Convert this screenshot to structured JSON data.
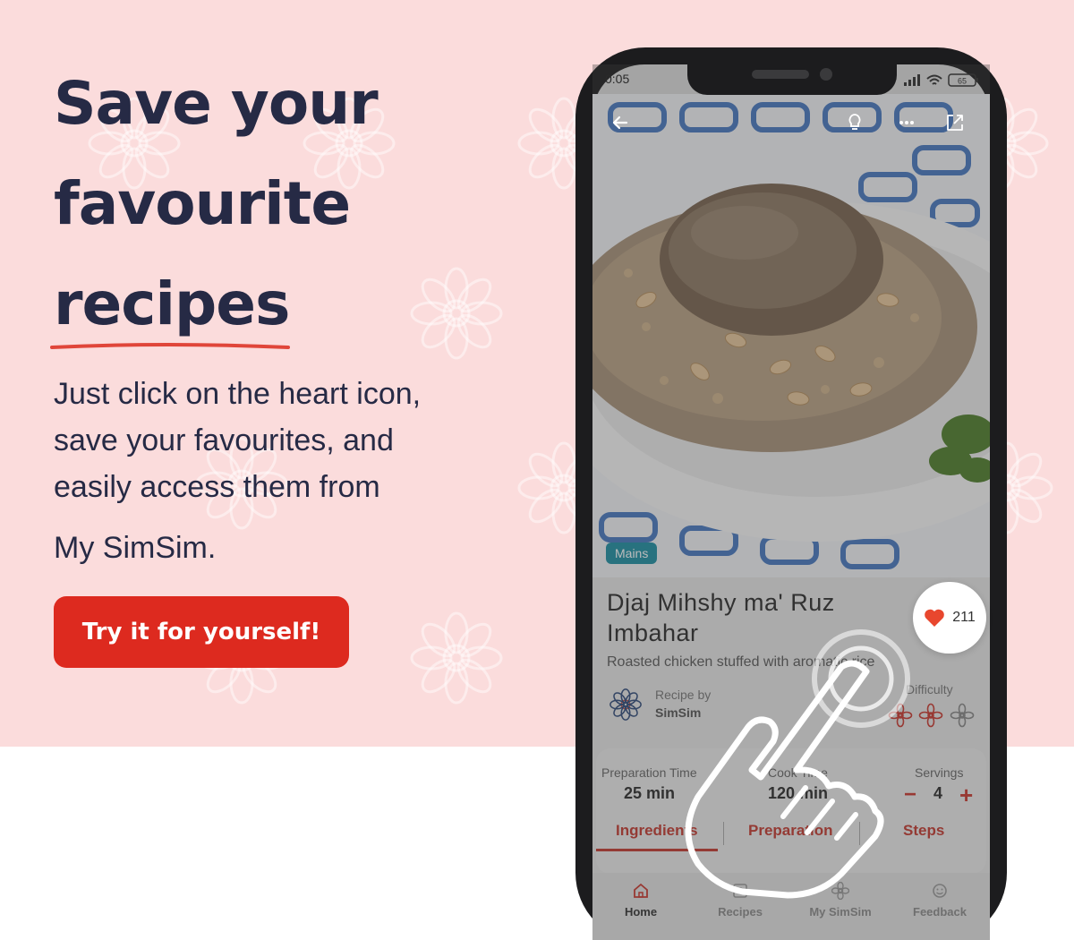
{
  "hero": {
    "headline_line1": "Save your",
    "headline_line2": "favourite",
    "headline_line3": "recipes",
    "body_line1": "Just click on the heart icon,",
    "body_line2": "save your favourites, and",
    "body_line3": "easily access them from",
    "body_line4": "My SimSim.",
    "cta_label": "Try it for yourself!"
  },
  "colors": {
    "background_pink": "#fbdcdc",
    "headline": "#262a45",
    "cta": "#dd2a1f",
    "accent_red": "#c43a30",
    "badge_teal": "#1e8fa3"
  },
  "phone": {
    "status_time": "0:05",
    "battery": "65",
    "top_icons": [
      "back-arrow-icon",
      "lightbulb-icon",
      "more-dots-icon",
      "share-icon"
    ],
    "recipe": {
      "category": "Mains",
      "title_line1": "Djaj Mihshy ma' Ruz",
      "title_line2": "Imbahar",
      "subtitle": "Roasted chicken stuffed with aromatic rice",
      "recipe_by_label": "Recipe by",
      "author": "SimSim",
      "difficulty_label": "Difficulty",
      "difficulty_level": 2,
      "difficulty_max": 3,
      "favourite_count": "211"
    },
    "info": {
      "prep_label": "Preparation Time",
      "prep_value": "25 min",
      "cook_label": "Cook Time",
      "cook_value": "120 min",
      "servings_label": "Servings",
      "servings_value": "4",
      "minus": "−",
      "plus": "+"
    },
    "tabs": [
      {
        "label": "Ingredients"
      },
      {
        "label": "Preparation"
      },
      {
        "label": "Steps"
      }
    ],
    "nav": [
      {
        "label": "Home",
        "icon": "home-icon"
      },
      {
        "label": "Recipes",
        "icon": "recipes-icon"
      },
      {
        "label": "My SimSim",
        "icon": "simsim-flower-icon"
      },
      {
        "label": "Feedback",
        "icon": "smiley-icon"
      }
    ]
  }
}
